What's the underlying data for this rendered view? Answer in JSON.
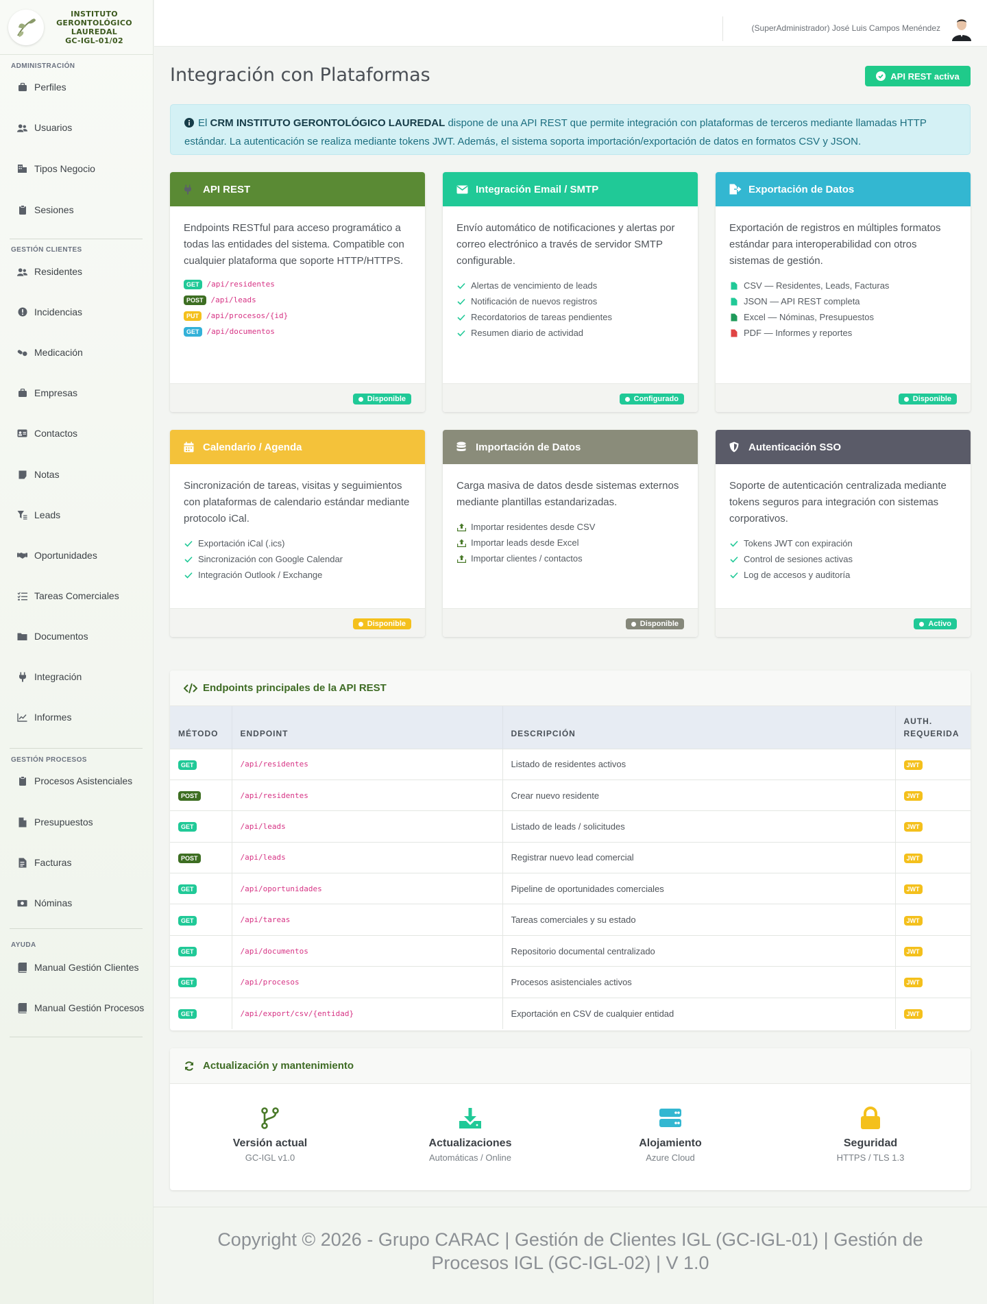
{
  "brand": {
    "line1": "INSTITUTO",
    "line2": "GERONTOLÓGICO",
    "line3": "LAUREDAL",
    "line4": "GC-IGL-01/02"
  },
  "sidebar": {
    "sections": [
      {
        "title": "ADMINISTRACIÓN",
        "items": [
          {
            "label": "Perfiles",
            "icon": "briefcase-icon"
          },
          {
            "label": "Usuarios",
            "icon": "users-icon"
          },
          {
            "label": "Tipos Negocio",
            "icon": "building-icon"
          },
          {
            "label": "Sesiones",
            "icon": "clipboard-icon"
          }
        ]
      },
      {
        "title": "GESTIÓN CLIENTES",
        "items": [
          {
            "label": "Residentes",
            "icon": "users-icon"
          },
          {
            "label": "Incidencias",
            "icon": "alert-circle-icon"
          },
          {
            "label": "Medicación",
            "icon": "pills-icon"
          },
          {
            "label": "Empresas",
            "icon": "briefcase-icon"
          },
          {
            "label": "Contactos",
            "icon": "id-card-icon"
          },
          {
            "label": "Notas",
            "icon": "note-icon"
          },
          {
            "label": "Leads",
            "icon": "funnel-icon"
          },
          {
            "label": "Oportunidades",
            "icon": "handshake-icon"
          },
          {
            "label": "Tareas Comerciales",
            "icon": "task-list-icon"
          },
          {
            "label": "Documentos",
            "icon": "folder-icon"
          },
          {
            "label": "Integración",
            "icon": "plug-icon"
          },
          {
            "label": "Informes",
            "icon": "chart-line-icon"
          }
        ]
      },
      {
        "title": "GESTIÓN PROCESOS",
        "items": [
          {
            "label": "Procesos Asistenciales",
            "icon": "clipboard-icon"
          },
          {
            "label": "Presupuestos",
            "icon": "file-icon"
          },
          {
            "label": "Facturas",
            "icon": "invoice-icon"
          },
          {
            "label": "Nóminas",
            "icon": "money-icon"
          }
        ]
      },
      {
        "title": "AYUDA",
        "items": [
          {
            "label": "Manual Gestión Clientes",
            "icon": "book-icon"
          },
          {
            "label": "Manual Gestión Procesos",
            "icon": "book-icon"
          }
        ]
      }
    ]
  },
  "topbar": {
    "user": "(SuperAdministrador) José Luis Campos Menéndez"
  },
  "page": {
    "title": "Integración con Plataformas",
    "badge": "API REST activa"
  },
  "alert": {
    "pre": "El ",
    "strong": "CRM INSTITUTO GERONTOLÓGICO LAUREDAL",
    "post": " dispone de una API REST que permite integración con plataformas de terceros mediante llamadas HTTP estándar. La autenticación se realiza mediante tokens JWT. Además, el sistema soporta importación/exportación de datos en formatos CSV y JSON."
  },
  "cards": [
    {
      "title": "API REST",
      "color": "#5a8a34",
      "icon": "plug-icon",
      "desc": "Endpoints RESTful para acceso programático a todas las entidades del sistema. Compatible con cualquier plataforma que soporte HTTP/HTTPS.",
      "endpoints": [
        {
          "method": "GET",
          "path": "/api/residentes"
        },
        {
          "method": "POST",
          "path": "/api/leads"
        },
        {
          "method": "PUT",
          "path": "/api/procesos/{id}"
        },
        {
          "method": "GET",
          "path": "/api/documentos"
        }
      ],
      "status": "Disponible",
      "status_color": "#20c997"
    },
    {
      "title": "Integración Email / SMTP",
      "color": "#20c997",
      "icon": "envelope-icon",
      "desc": "Envío automático de notificaciones y alertas por correo electrónico a través de servidor SMTP configurable.",
      "items": [
        "Alertas de vencimiento de leads",
        "Notificación de nuevos registros",
        "Recordatorios de tareas pendientes",
        "Resumen diario de actividad"
      ],
      "status": "Configurado",
      "status_color": "#20c997"
    },
    {
      "title": "Exportación de Datos",
      "color": "#33b7d1",
      "icon": "file-export-icon",
      "desc": "Exportación de registros en múltiples formatos estándar para interoperabilidad con otros sistemas de gestión.",
      "items": [
        "CSV — Residentes, Leads, Facturas",
        "JSON — API REST completa",
        "Excel — Nóminas, Presupuestos",
        "PDF — Informes y reportes"
      ],
      "status": "Disponible",
      "status_color": "#20c997"
    },
    {
      "title": "Calendario / Agenda",
      "color": "#f4c23a",
      "icon": "calendar-icon",
      "desc": "Sincronización de tareas, visitas y seguimientos con plataformas de calendario estándar mediante protocolo iCal.",
      "items": [
        "Exportación iCal (.ics)",
        "Sincronización con Google Calendar",
        "Integración Outlook / Exchange"
      ],
      "status": "Disponible",
      "status_color": "#f4c01c"
    },
    {
      "title": "Importación de Datos",
      "color": "#8a8c7a",
      "icon": "database-icon",
      "desc": "Carga masiva de datos desde sistemas externos mediante plantillas estandarizadas.",
      "items": [
        "Importar residentes desde CSV",
        "Importar leads desde Excel",
        "Importar clientes / contactos"
      ],
      "status": "Disponible",
      "status_color": "#85877a"
    },
    {
      "title": "Autenticación SSO",
      "color": "#5a5b68",
      "icon": "shield-icon",
      "desc": "Soporte de autenticación centralizada mediante tokens seguros para integración con sistemas corporativos.",
      "items": [
        "Tokens JWT con expiración",
        "Control de sesiones activas",
        "Log de accesos y auditoría"
      ],
      "status": "Activo",
      "status_color": "#20c997"
    }
  ],
  "endpoints_panel": {
    "title": "Endpoints principales de la API REST",
    "headers": {
      "method": "MÉTODO",
      "endpoint": "ENDPOINT",
      "desc": "DESCRIPCIÓN",
      "auth": "AUTH. REQUERIDA"
    },
    "rows": [
      {
        "method": "GET",
        "path": "/api/residentes",
        "desc": "Listado de residentes activos",
        "auth": "JWT"
      },
      {
        "method": "POST",
        "path": "/api/residentes",
        "desc": "Crear nuevo residente",
        "auth": "JWT"
      },
      {
        "method": "GET",
        "path": "/api/leads",
        "desc": "Listado de leads / solicitudes",
        "auth": "JWT"
      },
      {
        "method": "POST",
        "path": "/api/leads",
        "desc": "Registrar nuevo lead comercial",
        "auth": "JWT"
      },
      {
        "method": "GET",
        "path": "/api/oportunidades",
        "desc": "Pipeline de oportunidades comerciales",
        "auth": "JWT"
      },
      {
        "method": "GET",
        "path": "/api/tareas",
        "desc": "Tareas comerciales y su estado",
        "auth": "JWT"
      },
      {
        "method": "GET",
        "path": "/api/documentos",
        "desc": "Repositorio documental centralizado",
        "auth": "JWT"
      },
      {
        "method": "GET",
        "path": "/api/procesos",
        "desc": "Procesos asistenciales activos",
        "auth": "JWT"
      },
      {
        "method": "GET",
        "path": "/api/export/csv/{entidad}",
        "desc": "Exportación en CSV de cualquier entidad",
        "auth": "JWT"
      }
    ]
  },
  "maintenance": {
    "title": "Actualización y mantenimiento",
    "items": [
      {
        "title": "Versión actual",
        "sub": "GC-IGL v1.0",
        "icon": "code-branch-icon",
        "color": "#4a7a2a"
      },
      {
        "title": "Actualizaciones",
        "sub": "Automáticas / Online",
        "icon": "download-icon",
        "color": "#20c997"
      },
      {
        "title": "Alojamiento",
        "sub": "Azure Cloud",
        "icon": "server-icon",
        "color": "#33b7d1"
      },
      {
        "title": "Seguridad",
        "sub": "HTTPS / TLS 1.3",
        "icon": "lock-icon",
        "color": "#f4c01c"
      }
    ]
  },
  "footer": {
    "text": "Copyright © 2026 - Grupo CARAC | Gestión de Clientes IGL (GC-IGL-01) | Gestión de Procesos IGL (GC-IGL-02) | V 1.0"
  }
}
